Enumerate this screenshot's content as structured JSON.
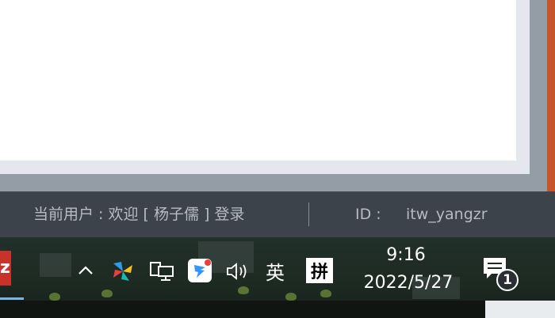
{
  "status_bar": {
    "current_user": "当前用户 : 欢迎 [ 杨子儒 ] 登录",
    "id_label": "ID :",
    "id_value": "itw_yangzr"
  },
  "taskbar": {
    "app_tile_letter": "z",
    "tray": {
      "icons": [
        "chevron-up-icon",
        "pinwheel-app-icon",
        "network-icon",
        "dingtalk-icon",
        "volume-icon"
      ],
      "language": "英",
      "ime": "拼"
    },
    "clock": {
      "time": "9:16",
      "date": "2022/5/27"
    },
    "notifications": {
      "count": "1"
    }
  },
  "colors": {
    "status_bar_bg": "#3d434b",
    "status_text": "#b7bcc3",
    "taskbar_bg": "#1c2a22",
    "accent_orange": "#c8552a"
  }
}
